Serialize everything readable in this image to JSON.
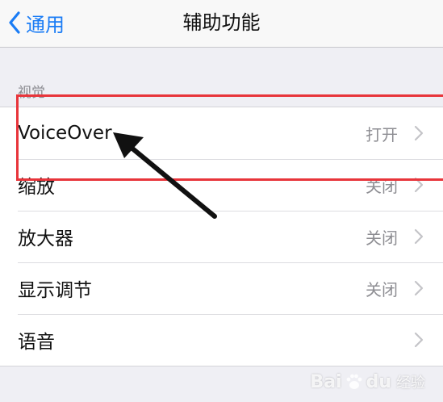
{
  "navbar": {
    "back_label": "通用",
    "title": "辅助功能"
  },
  "section": {
    "header": "视觉"
  },
  "rows": [
    {
      "label": "VoiceOver",
      "value": "打开"
    },
    {
      "label": "缩放",
      "value": "关闭"
    },
    {
      "label": "放大器",
      "value": "关闭"
    },
    {
      "label": "显示调节",
      "value": "关闭"
    },
    {
      "label": "语音",
      "value": ""
    }
  ],
  "watermark": {
    "brand": "Bai",
    "brand_tail": "du",
    "sub": "经验"
  },
  "colors": {
    "accent": "#1a7cf5",
    "highlight": "#e8353b",
    "background": "#efeff4"
  }
}
